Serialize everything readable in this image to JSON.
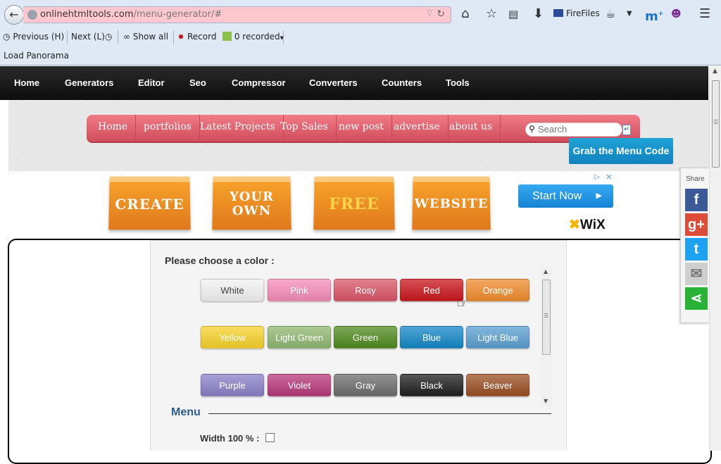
{
  "browser": {
    "url_domain": "onlinehtmltools.com",
    "url_path": "/menu-generator/#",
    "toolbar": {
      "firefiles_label": "FireFiles"
    },
    "row2": {
      "previous_label": "Previous (H)",
      "next_label": "Next (L)",
      "show_all_label": "Show all",
      "record_label": "Record",
      "recorded_label": "0 recorded"
    },
    "row3_label": "Load Panorama"
  },
  "topnav": {
    "items": [
      "Home",
      "Generators",
      "Editor",
      "Seo",
      "Compressor",
      "Converters",
      "Counters",
      "Tools"
    ]
  },
  "demo_menu": {
    "items": [
      "Home",
      "portfolios",
      "Latest Projects",
      "Top Sales",
      "new post",
      "advertise",
      "about us"
    ],
    "search_placeholder": "Search",
    "grab_button": "Grab the Menu Code",
    "accent_color": "#e05d6b"
  },
  "ad": {
    "words": [
      "CREATE",
      "YOUR OWN",
      "FREE",
      "WEBSITE"
    ],
    "cta": "Start Now",
    "brand": "WiX"
  },
  "color_chooser": {
    "label": "Please choose a color :",
    "colors": [
      {
        "name": "White",
        "bg": "#f2f2f2",
        "fg": "#444"
      },
      {
        "name": "Pink",
        "bg": "#f48cb8",
        "fg": "#ffffff"
      },
      {
        "name": "Rosy",
        "bg": "#d95566",
        "fg": "#ffffff"
      },
      {
        "name": "Red",
        "bg": "#c8161d",
        "fg": "#ffffff"
      },
      {
        "name": "Orange",
        "bg": "#ef8c2c",
        "fg": "#ffffff"
      },
      {
        "name": "Yellow",
        "bg": "#f7d22b",
        "fg": "#ffffff"
      },
      {
        "name": "Light Green",
        "bg": "#8fb870",
        "fg": "#ffffff"
      },
      {
        "name": "Green",
        "bg": "#4f8a1e",
        "fg": "#ffffff"
      },
      {
        "name": "Blue",
        "bg": "#1487c6",
        "fg": "#ffffff"
      },
      {
        "name": "Light Blue",
        "bg": "#5a9fd1",
        "fg": "#ffffff"
      },
      {
        "name": "Purple",
        "bg": "#8a80c8",
        "fg": "#ffffff"
      },
      {
        "name": "Violet",
        "bg": "#b8387a",
        "fg": "#ffffff"
      },
      {
        "name": "Gray",
        "bg": "#6d6d6d",
        "fg": "#ffffff"
      },
      {
        "name": "Black",
        "bg": "#1f1f1f",
        "fg": "#ffffff"
      },
      {
        "name": "Beaver",
        "bg": "#9a4f23",
        "fg": "#ffffff"
      }
    ]
  },
  "menu_section": {
    "heading": "Menu",
    "width_label": "Width 100 % :"
  },
  "share": {
    "label": "Share",
    "items": [
      {
        "name": "facebook",
        "glyph": "f",
        "color": "#3b5998"
      },
      {
        "name": "google-plus",
        "glyph": "g+",
        "color": "#dd4b39"
      },
      {
        "name": "twitter",
        "glyph": "t",
        "color": "#1da1f2"
      },
      {
        "name": "email",
        "glyph": "✉",
        "color": "#cfcfcf"
      },
      {
        "name": "sharethis",
        "glyph": "⋖",
        "color": "#28b336"
      }
    ]
  }
}
